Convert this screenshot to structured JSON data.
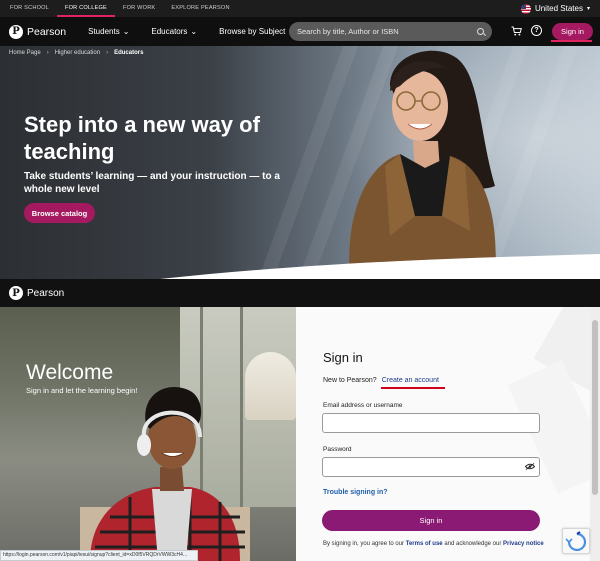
{
  "utility_bar": {
    "links": [
      "FOR SCHOOL",
      "FOR COLLEGE",
      "FOR WORK",
      "EXPLORE PEARSON"
    ],
    "active": "FOR COLLEGE",
    "region": "United States"
  },
  "main_nav": {
    "brand": "Pearson",
    "items": [
      "Students",
      "Educators",
      "Browse by Subject"
    ],
    "search_placeholder": "Search by title, Author or ISBN",
    "signin_label": "Sign in"
  },
  "breadcrumb": [
    "Home Page",
    "Higher education",
    "Educators"
  ],
  "hero": {
    "title": "Step into a new way of teaching",
    "subtitle": "Take students’ learning — and your instruction — to a whole new level",
    "button": "Browse catalog"
  },
  "signin_page": {
    "brand": "Pearson",
    "welcome": "Welcome",
    "welcome_sub": "Sign in and let the learning begin!",
    "title": "Sign in",
    "new_text": "New to Pearson?",
    "create_link": "Create an account",
    "email_label": "Email address or username",
    "email_value": "",
    "password_label": "Password",
    "password_value": "",
    "trouble_link": "Trouble signing in?",
    "submit": "Sign in",
    "legal_prefix": "By signing in, you agree to our",
    "terms_link": "Terms of use",
    "legal_mid": "and acknowledge our",
    "privacy_link": "Privacy notice",
    "status_url": "https://login.pearson.com/v1/piapi/iesui/signup?client_id=xD0f5VRQDrVWW3cH4..."
  },
  "colors": {
    "accent": "#a4195f",
    "primary_button": "#8a1a74",
    "underline_red": "#d0021b",
    "link_blue": "#1f3b8a"
  },
  "icons": [
    "us-flag-icon",
    "chevron-down-icon",
    "search-icon",
    "cart-icon",
    "help-icon",
    "eye-slash-icon",
    "recaptcha-icon",
    "pearson-logo-icon"
  ]
}
